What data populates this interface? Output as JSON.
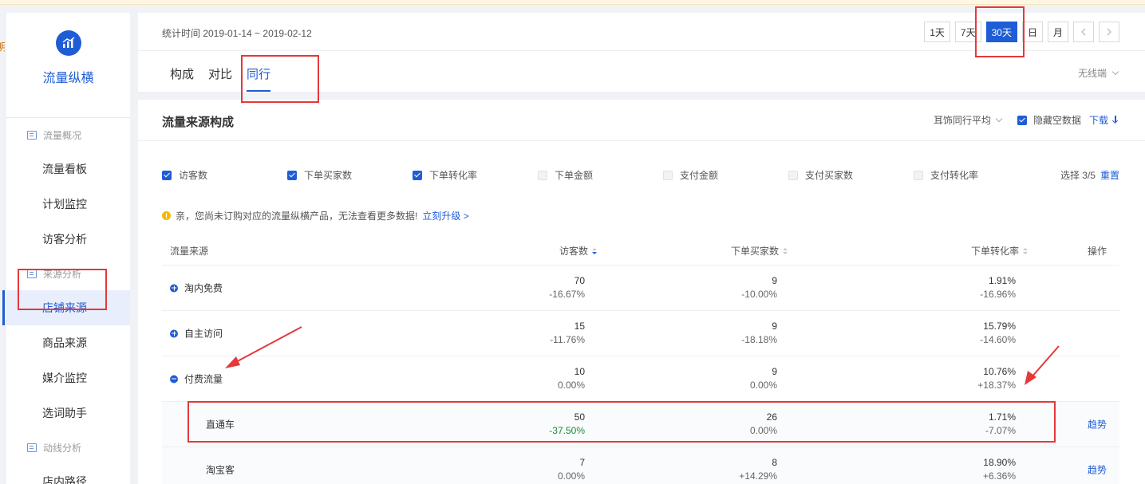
{
  "app": {
    "name": "流量纵横",
    "edge_char": "明",
    "colors": {
      "accent": "#1f5dd6",
      "annotation": "#e5383b",
      "positive_change": "#1a8a3a"
    }
  },
  "sidebar": {
    "sections": [
      {
        "label": "流量概况",
        "icon": "document-icon",
        "items": [
          "流量看板",
          "计划监控",
          "访客分析"
        ]
      },
      {
        "label": "来源分析",
        "icon": "document-icon",
        "items": [
          "店铺来源",
          "商品来源",
          "媒介监控",
          "选词助手"
        ]
      },
      {
        "label": "动线分析",
        "icon": "document-icon",
        "items": [
          "店内路径"
        ]
      }
    ],
    "active_item": "店铺来源"
  },
  "header": {
    "time_label": "统计时间 2019-01-14 ~ 2019-02-12",
    "range_buttons": [
      "1天",
      "7天",
      "30天",
      "日",
      "月"
    ],
    "active_range": "30天",
    "prev_icon": "chevron-left-icon",
    "next_icon": "chevron-right-icon",
    "tabs": [
      "构成",
      "对比",
      "同行"
    ],
    "active_tab": "同行",
    "device": "无线端"
  },
  "content": {
    "title": "流量来源构成",
    "compare_select": "耳饰同行平均",
    "hide_empty_label": "隐藏空数据",
    "hide_empty_checked": true,
    "download_label": "下载",
    "metrics": [
      {
        "label": "访客数",
        "checked": true
      },
      {
        "label": "下单买家数",
        "checked": true
      },
      {
        "label": "下单转化率",
        "checked": true
      },
      {
        "label": "下单金额",
        "checked": false
      },
      {
        "label": "支付金额",
        "checked": false
      },
      {
        "label": "支付买家数",
        "checked": false
      },
      {
        "label": "支付转化率",
        "checked": false
      }
    ],
    "selection_text": "选择 3/5",
    "reset_label": "重置",
    "notice_text": "亲，您尚未订购对应的流量纵横产品，无法查看更多数据!",
    "upgrade_link": "立刻升级 >",
    "table": {
      "headers": [
        "流量来源",
        "访客数",
        "下单买家数",
        "下单转化率",
        "操作"
      ],
      "rows": [
        {
          "source": "淘内免费",
          "type": "parent",
          "expanded": false,
          "visitors": "70",
          "visitors_delta": "-16.67%",
          "buyers": "9",
          "buyers_delta": "-10.00%",
          "rate": "1.91%",
          "rate_delta": "-16.96%",
          "action": ""
        },
        {
          "source": "自主访问",
          "type": "parent",
          "expanded": false,
          "visitors": "15",
          "visitors_delta": "-11.76%",
          "buyers": "9",
          "buyers_delta": "-18.18%",
          "rate": "15.79%",
          "rate_delta": "-14.60%",
          "action": ""
        },
        {
          "source": "付费流量",
          "type": "parent",
          "expanded": true,
          "visitors": "10",
          "visitors_delta": "0.00%",
          "buyers": "9",
          "buyers_delta": "0.00%",
          "rate": "10.76%",
          "rate_delta": "+18.37%",
          "action": ""
        },
        {
          "source": "直通车",
          "type": "child",
          "visitors": "50",
          "visitors_delta": "-37.50%",
          "buyers": "26",
          "buyers_delta": "0.00%",
          "rate": "1.71%",
          "rate_delta": "-7.07%",
          "action": "趋势"
        },
        {
          "source": "淘宝客",
          "type": "child",
          "visitors": "7",
          "visitors_delta": "0.00%",
          "buyers": "8",
          "buyers_delta": "+14.29%",
          "rate": "18.90%",
          "rate_delta": "+6.36%",
          "action": "趋势"
        }
      ]
    }
  }
}
